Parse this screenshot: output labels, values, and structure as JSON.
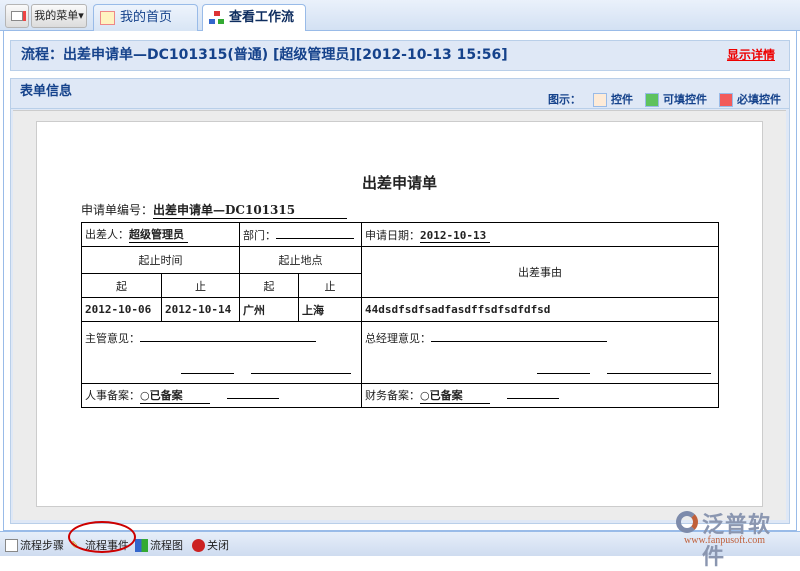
{
  "topbar": {
    "menu_label": "我的菜单",
    "tabs": [
      {
        "label": "我的首页"
      },
      {
        "label": "查看工作流"
      }
    ]
  },
  "flow": {
    "title": "流程：出差申请单—DC101315(普通) [超级管理员][2012-10-13 15:56]",
    "detail_link": "显示详情"
  },
  "form_info": {
    "header": "表单信息",
    "legend_label": "图示：",
    "legend": [
      {
        "label": "控件",
        "color": "#fdebd8"
      },
      {
        "label": "可填控件",
        "color": "#5ec25e"
      },
      {
        "label": "必填控件",
        "color": "#f25b5b"
      }
    ]
  },
  "form": {
    "title": "出差申请单",
    "no_label": "申请单编号：",
    "no_value": "出差申请单—DC101315",
    "traveler_label": "出差人：",
    "traveler": "超级管理员",
    "dept_label": "部门：",
    "date_label": "申请日期：",
    "date": "2012-10-13",
    "time_range": "起止时间",
    "place_range": "起止地点",
    "reason_label": "出差事由",
    "start": "起",
    "end": "止",
    "start_date": "2012-10-06",
    "end_date": "2012-10-14",
    "from": "广州",
    "to": "上海",
    "reason": "44dsdfsdfsadfasdffsdfsdfdfsd",
    "supervisor_label": "主管意见：",
    "gm_label": "总经理意见：",
    "hr_label": "人事备案：",
    "hr_value": "○已备案",
    "fin_label": "财务备案：",
    "fin_value": "○已备案"
  },
  "bottom": {
    "steps": "流程步骤",
    "events": "流程事件",
    "chart": "流程图",
    "close": "关闭"
  },
  "logo": {
    "text": "泛普软件",
    "url": "www.fanpusoft.com"
  }
}
